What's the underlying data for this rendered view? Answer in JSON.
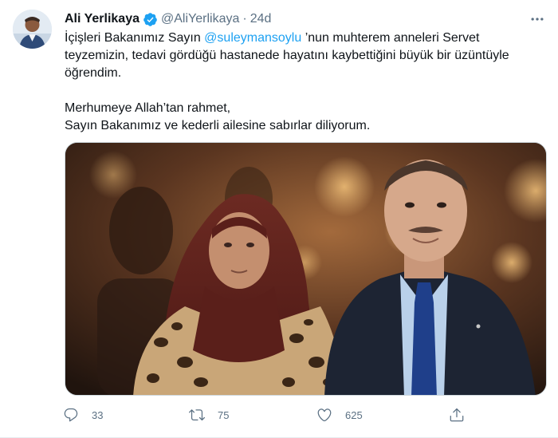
{
  "tweet": {
    "author": {
      "display_name": "Ali Yerlikaya",
      "handle": "@AliYerlikaya",
      "separator": "·",
      "time": "24d",
      "verified": true,
      "avatar_icon": "avatar-photo"
    },
    "text": {
      "line_intro": "İçişleri Bakanımız Sayın ",
      "mention": "@suleymansoylu",
      "line_rest": " ’nun muhterem anneleri Servet teyzemizin, tedavi gördüğü hastanede hayatını kaybettiğini büyük bir üzüntüyle öğrendim.",
      "para2_line1": "Merhumeye Allah’tan rahmet,",
      "para2_line2": "Sayın Bakanımız ve kederli ailesine sabırlar diliyorum."
    },
    "actions": {
      "reply_count": "33",
      "retweet_count": "75",
      "like_count": "625"
    },
    "colors": {
      "accent": "#1da1f2",
      "secondary_text": "#5b7083",
      "primary_text": "#0f1419",
      "verified": "#1da1f2"
    },
    "icons": [
      "more-icon",
      "verified-icon",
      "reply-icon",
      "retweet-icon",
      "like-icon",
      "share-icon"
    ]
  }
}
